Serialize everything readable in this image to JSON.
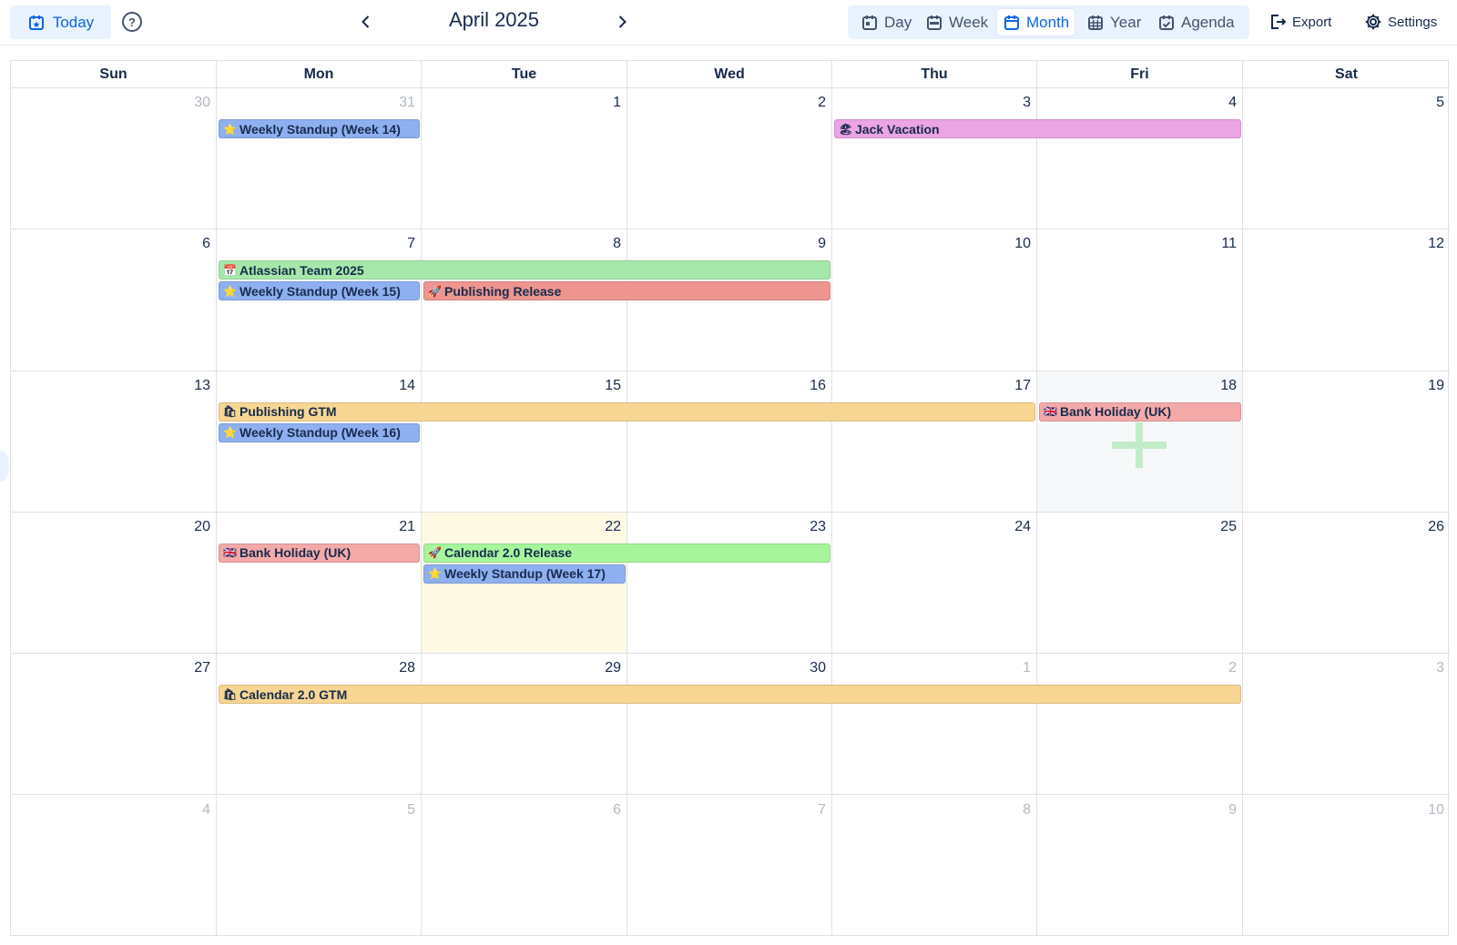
{
  "toolbar": {
    "today_label": "Today",
    "title": "April 2025",
    "prev_icon": "chevron-left-icon",
    "next_icon": "chevron-right-icon",
    "views": [
      {
        "label": "Day",
        "icon": "calendar-day-icon",
        "active": false
      },
      {
        "label": "Week",
        "icon": "calendar-week-icon",
        "active": false
      },
      {
        "label": "Month",
        "icon": "calendar-month-icon",
        "active": true
      },
      {
        "label": "Year",
        "icon": "calendar-year-icon",
        "active": false
      },
      {
        "label": "Agenda",
        "icon": "calendar-check-icon",
        "active": false
      }
    ],
    "export_label": "Export",
    "settings_label": "Settings"
  },
  "calendar": {
    "weekdays": [
      "Sun",
      "Mon",
      "Tue",
      "Wed",
      "Thu",
      "Fri",
      "Sat"
    ],
    "weeks": [
      [
        "30",
        "31",
        "1",
        "2",
        "3",
        "4",
        "5"
      ],
      [
        "6",
        "7",
        "8",
        "9",
        "10",
        "11",
        "12"
      ],
      [
        "13",
        "14",
        "15",
        "16",
        "17",
        "18",
        "19"
      ],
      [
        "20",
        "21",
        "22",
        "23",
        "24",
        "25",
        "26"
      ],
      [
        "27",
        "28",
        "29",
        "30",
        "1",
        "2",
        "3"
      ],
      [
        "4",
        "5",
        "6",
        "7",
        "8",
        "9",
        "10"
      ]
    ],
    "today": "22",
    "events": [
      {
        "title": "Weekly Standup (Week 14)",
        "icon": "⭐",
        "color": "#8fb0f0"
      },
      {
        "title": "Jack Vacation",
        "icon": "🏖",
        "color": "#eca5e4"
      },
      {
        "title": "Atlassian Team 2025",
        "icon": "📅",
        "color": "#a6e8a9"
      },
      {
        "title": "Weekly Standup (Week 15)",
        "icon": "⭐",
        "color": "#8fb0f0"
      },
      {
        "title": "Publishing Release",
        "icon": "🚀",
        "color": "#ee9590"
      },
      {
        "title": "Publishing GTM",
        "icon": "🛍",
        "color": "#f7d693"
      },
      {
        "title": "Bank Holiday (UK)",
        "icon": "🇬🇧",
        "color": "#f4a9a9"
      },
      {
        "title": "Weekly Standup (Week 16)",
        "icon": "⭐",
        "color": "#8fb0f0"
      },
      {
        "title": "Bank Holiday (UK)",
        "icon": "🇬🇧",
        "color": "#f4a9a9"
      },
      {
        "title": "Calendar 2.0 Release",
        "icon": "🚀",
        "color": "#a6f59c"
      },
      {
        "title": "Weekly Standup (Week 17)",
        "icon": "⭐",
        "color": "#8fb0f0"
      },
      {
        "title": "Calendar 2.0 GTM",
        "icon": "🛍",
        "color": "#f7d693"
      }
    ]
  }
}
